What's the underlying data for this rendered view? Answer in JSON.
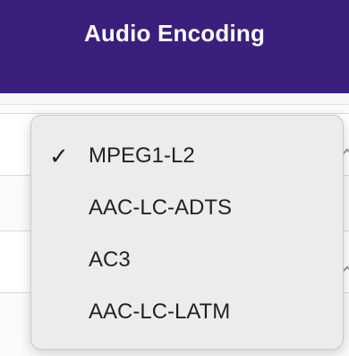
{
  "header": {
    "title": "Audio Encoding"
  },
  "dropdown": {
    "selected": "MPEG1-L2",
    "check_glyph": "✓",
    "options": [
      {
        "label": "MPEG1-L2",
        "checked": true
      },
      {
        "label": "AAC-LC-ADTS",
        "checked": false
      },
      {
        "label": "AC3",
        "checked": false
      },
      {
        "label": "AAC-LC-LATM",
        "checked": false
      }
    ]
  },
  "colors": {
    "header_bg": "#3a1f7c",
    "header_text": "#ffffff",
    "menu_bg": "#ececec",
    "menu_text": "#222222"
  },
  "icons": {
    "checkmark": "checkmark-icon",
    "chevron": "chevron-icon"
  }
}
